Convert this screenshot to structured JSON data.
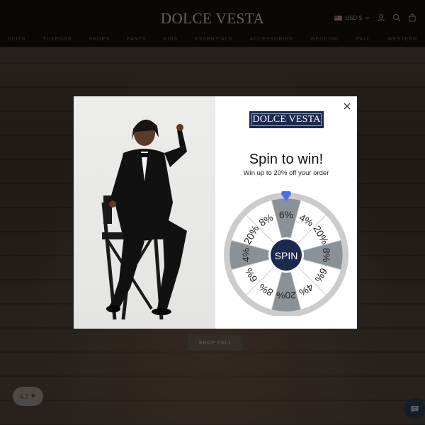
{
  "header": {
    "logo": "DOLCE VESTA",
    "currency": "USD $",
    "nav": [
      "SUITS",
      "TUXEDOS",
      "SHOES",
      "PANTS",
      "KIDS",
      "ESSENTIALS",
      "ACCESSORIES",
      "WEDDING",
      "FALL",
      "WESTERN"
    ]
  },
  "hero": {
    "cta": "SHOP FALL"
  },
  "rating": {
    "value": "4.7",
    "star": "★"
  },
  "popup": {
    "brand": "DOLCE VESTA",
    "title": "Spin to win!",
    "subtitle": "Win up to 20% off your order",
    "spin_label": "SPIN",
    "segments": [
      "6%",
      "4%",
      "20%",
      "8%",
      "6%",
      "4%",
      "20%",
      "8%",
      "6%",
      "4%",
      "20%",
      "8%"
    ],
    "colors": {
      "dark_segment": "#8a9299",
      "light_segment": "#ffffff",
      "wheel_rim": "#cccccc",
      "hub": "#1b2a4e",
      "pointer": "#4a6cf0"
    }
  }
}
